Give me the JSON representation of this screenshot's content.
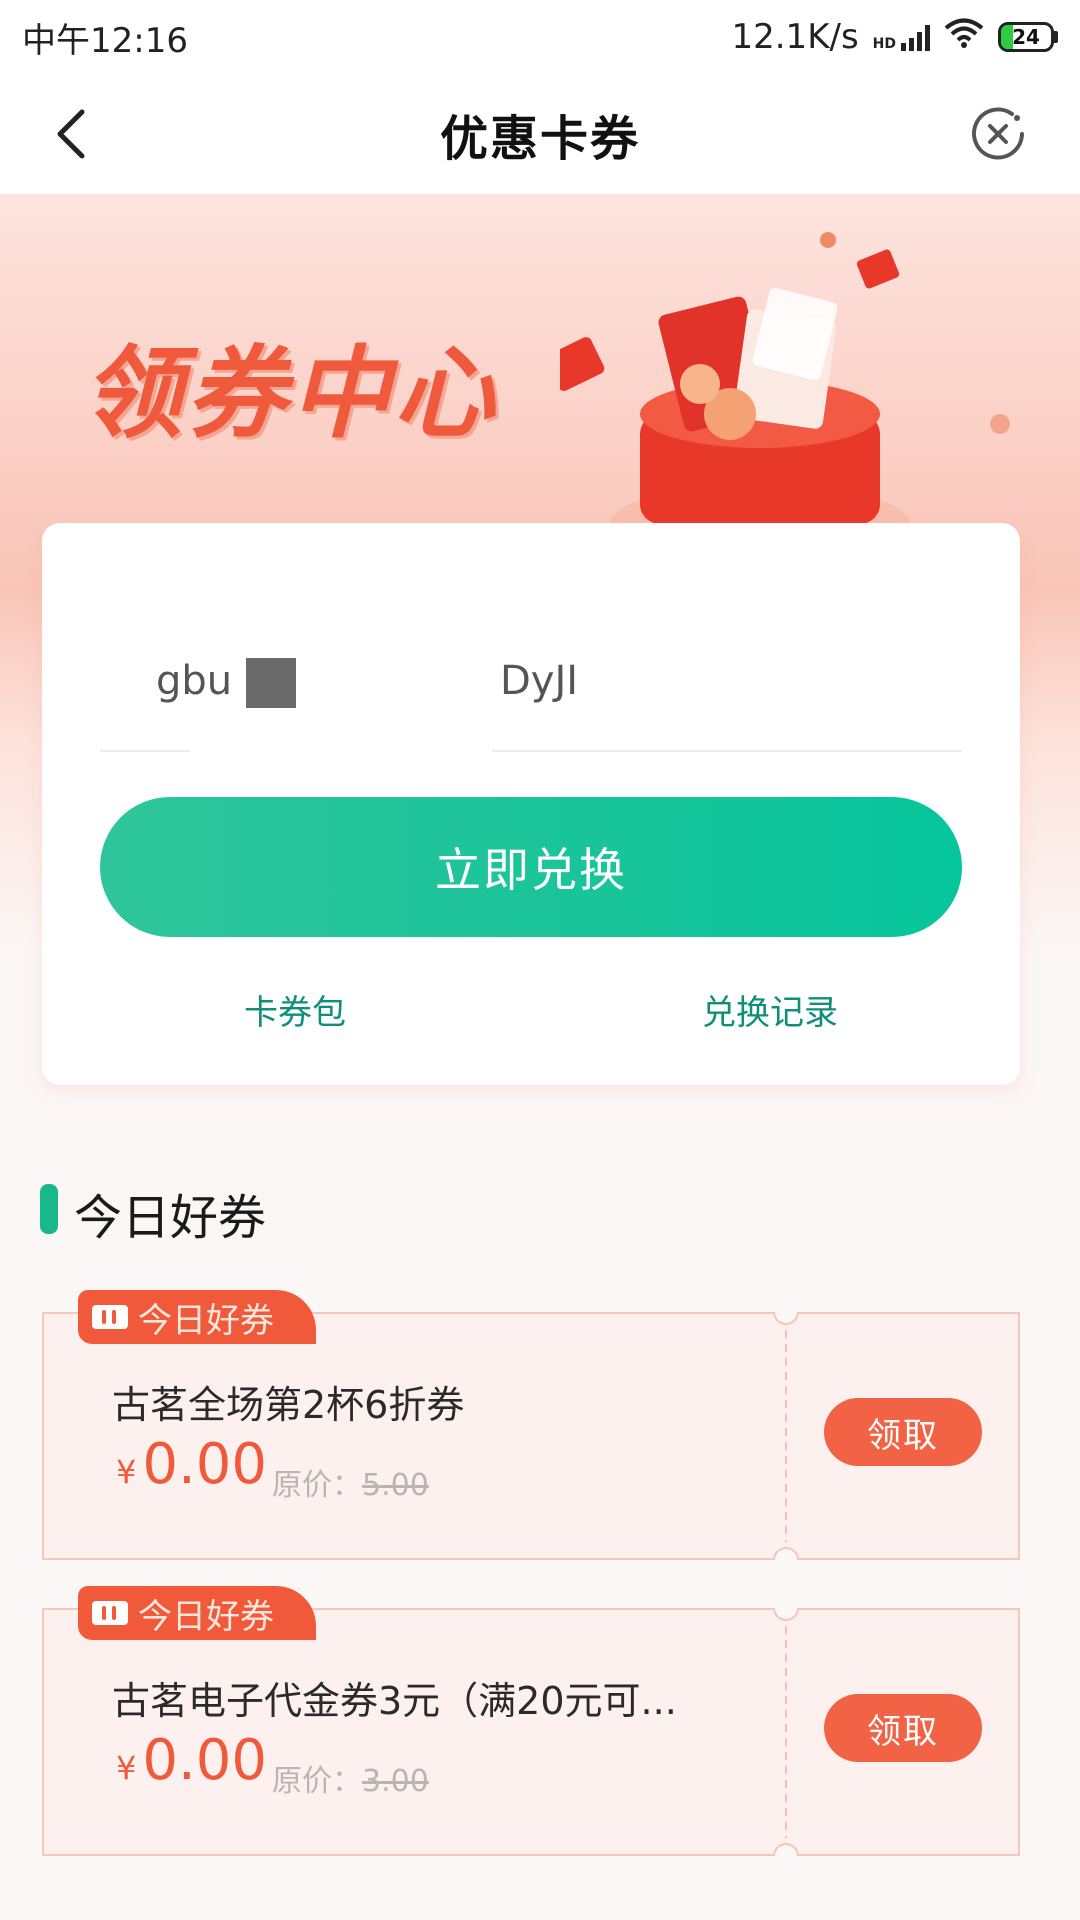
{
  "status_bar": {
    "time": "中午12:16",
    "network_speed": "12.1K/s",
    "battery_level": "24",
    "icons": [
      "hd-signal-icon",
      "wifi-icon",
      "battery-icon"
    ]
  },
  "header": {
    "title": "优惠卡券",
    "back_icon": "chevron-left-icon",
    "close_icon": "close-circle-icon"
  },
  "banner": {
    "title": "领券中心"
  },
  "redeem": {
    "code_part_1": "gbu",
    "code_part_2": "DyJI",
    "button_label": "立即兑换",
    "link_wallet": "卡券包",
    "link_history": "兑换记录"
  },
  "today": {
    "section_title": "今日好券",
    "coupons": [
      {
        "tag": "今日好券",
        "name": "古茗全场第2杯6折券",
        "currency": "¥",
        "price": "0.00",
        "original_label": "原价：",
        "original_price": "5.00",
        "action": "领取"
      },
      {
        "tag": "今日好券",
        "name": "古茗电子代金券3元（满20元可...",
        "currency": "¥",
        "price": "0.00",
        "original_label": "原价：",
        "original_price": "3.00",
        "action": "领取"
      }
    ]
  },
  "colors": {
    "accent_green": "#18c49a",
    "accent_orange": "#f05a3a",
    "link_teal": "#0f8f7a"
  }
}
